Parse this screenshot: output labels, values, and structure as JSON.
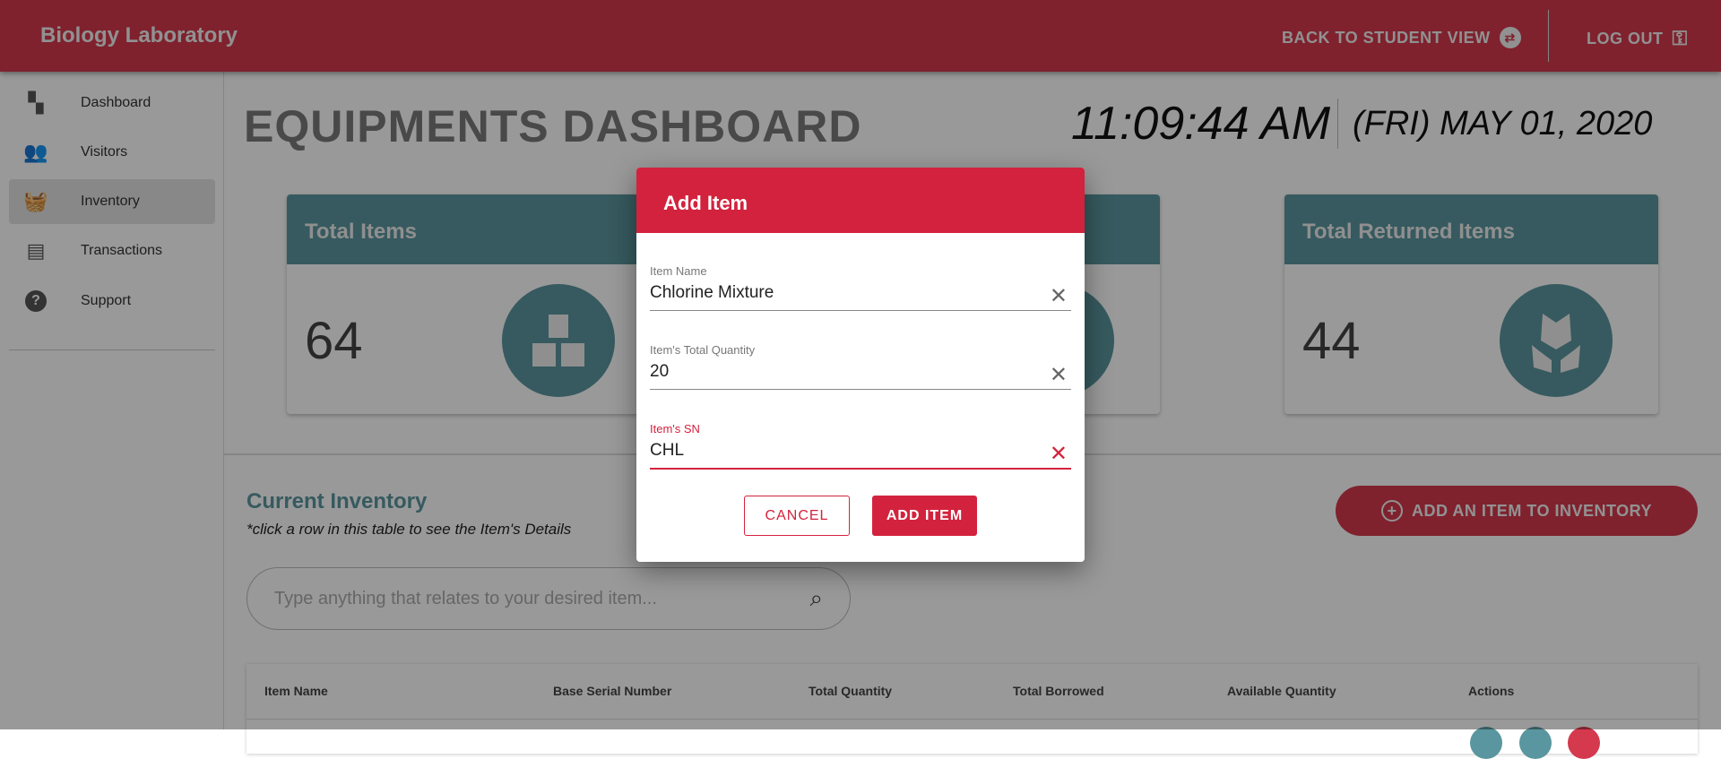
{
  "header": {
    "brand": "Biology Laboratory",
    "back_label": "BACK TO STUDENT VIEW",
    "logout_label": "LOG OUT",
    "color": "#d4394e"
  },
  "sidebar": {
    "items": [
      {
        "label": "Dashboard",
        "icon": "dashboard-icon"
      },
      {
        "label": "Visitors",
        "icon": "people-icon"
      },
      {
        "label": "Inventory",
        "icon": "basket-icon",
        "active": true
      },
      {
        "label": "Transactions",
        "icon": "store-icon"
      },
      {
        "label": "Support",
        "icon": "help-icon"
      }
    ]
  },
  "main": {
    "title": "EQUIPMENTS DASHBOARD",
    "time": "11:09:44 AM",
    "date": "(FRI) MAY 01, 2020",
    "cards": [
      {
        "title": "Total Items",
        "value": "64",
        "icon": "boxes-icon"
      },
      {
        "title": "",
        "value": "",
        "icon": ""
      },
      {
        "title": "Total Returned Items",
        "value": "44",
        "icon": "box-hands-icon"
      }
    ],
    "inventory_title": "Current Inventory",
    "inventory_hint": "*click a row in this table to see the Item's Details",
    "add_button": "ADD AN ITEM TO INVENTORY",
    "search_placeholder": "Type anything that relates to your desired item...",
    "table_headers": [
      "Item Name",
      "Base Serial Number",
      "Total Quantity",
      "Total Borrowed",
      "Available Quantity",
      "Actions"
    ]
  },
  "dialog": {
    "title": "Add Item",
    "fields": [
      {
        "label": "Item Name",
        "value": "Chlorine Mixture"
      },
      {
        "label": "Item's Total Quantity",
        "value": "20"
      },
      {
        "label": "Item's SN",
        "value": "CHL"
      }
    ],
    "cancel": "CANCEL",
    "submit": "ADD ITEM",
    "accent": "#d3223d"
  }
}
